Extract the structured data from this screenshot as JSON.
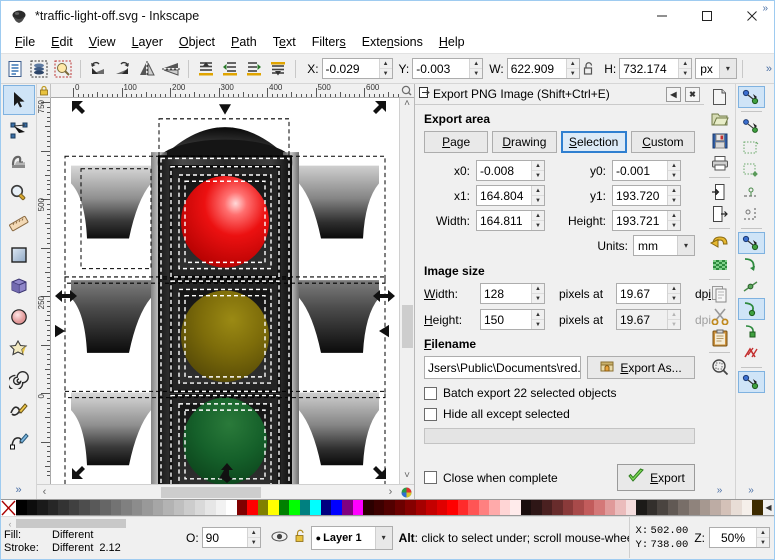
{
  "window": {
    "title": "*traffic-light-off.svg - Inkscape",
    "minimize": "—",
    "maximize": "☐",
    "close": "✕"
  },
  "menubar": {
    "items": [
      "File",
      "Edit",
      "View",
      "Layer",
      "Object",
      "Path",
      "Text",
      "Filters",
      "Extensions",
      "Help"
    ]
  },
  "toolbar": {
    "x_label": "X:",
    "x_value": "-0.029",
    "y_label": "Y:",
    "y_value": "-0.003",
    "w_label": "W:",
    "w_value": "622.909",
    "h_label": "H:",
    "h_value": "732.174",
    "units": "px",
    "lock_icon": "lock-open-icon",
    "overflow": "»",
    "command_icons": [
      "document-properties-icon",
      "xml-editor-icon",
      "zoom-drawing-icon",
      "rotate-ccw-90-icon",
      "rotate-cw-90-icon",
      "flip-horizontal-icon",
      "flip-vertical-icon",
      "raise-to-top-icon",
      "raise-icon",
      "lower-icon",
      "lower-to-bottom-icon"
    ]
  },
  "toolbox": {
    "tools": [
      {
        "name": "selector-tool",
        "active": true
      },
      {
        "name": "node-tool",
        "active": false
      },
      {
        "name": "tweak-tool",
        "active": false
      },
      {
        "name": "zoom-tool",
        "active": false
      },
      {
        "name": "measure-tool",
        "active": false
      },
      {
        "name": "rectangle-tool",
        "active": false
      },
      {
        "name": "box3d-tool",
        "active": false
      },
      {
        "name": "ellipse-tool",
        "active": false
      },
      {
        "name": "star-tool",
        "active": false
      },
      {
        "name": "spiral-tool",
        "active": false
      },
      {
        "name": "pencil-tool",
        "active": false
      },
      {
        "name": "pen-tool",
        "active": false
      }
    ],
    "more": "»"
  },
  "canvas": {
    "hruler_labels": [
      "0",
      "100",
      "200",
      "300",
      "400",
      "500",
      "600"
    ],
    "vruler_labels": [
      "750",
      "500",
      "250",
      "0"
    ],
    "drawing": "traffic-light-illustration",
    "scroll_left_arrow": "‹",
    "scroll_right_arrow": "›",
    "scroll_up_arrow": "˄",
    "scroll_down_arrow": "˅",
    "zoom_corner_icon": "zoom-icon",
    "lock_corner_icon": "ruler-lock-icon",
    "palette_corner_icon": "color-wheel-icon"
  },
  "export_panel": {
    "title": "Export PNG Image (Shift+Ctrl+E)",
    "dock_icon": "dock-icon",
    "collapse_button": "◀",
    "close_button": "✖",
    "area_section": "Export area",
    "area_buttons": [
      {
        "label": "Page",
        "selected": false
      },
      {
        "label": "Drawing",
        "selected": false
      },
      {
        "label": "Selection",
        "selected": true
      },
      {
        "label": "Custom",
        "selected": false
      }
    ],
    "x0_label": "x0:",
    "x0_value": "-0.008",
    "y0_label": "y0:",
    "y0_value": "-0.001",
    "x1_label": "x1:",
    "x1_value": "164.804",
    "y1_label": "y1:",
    "y1_value": "193.720",
    "width_label": "Width:",
    "width_value": "164.811",
    "height_label": "Height:",
    "height_value": "193.721",
    "units_label": "Units:",
    "units_value": "mm",
    "imgsize_section": "Image size",
    "img_width_label": "Width:",
    "img_width_value": "128",
    "img_height_label": "Height:",
    "img_height_value": "150",
    "pixels_at": "pixels at",
    "dpi_label": "dpi",
    "dpi_x_value": "19.67",
    "dpi_y_value": "19.67",
    "filename_section": "Filename",
    "filename_value": "Jsers\\Public\\Documents\\red.",
    "export_as_label": "Export As...",
    "export_as_icon": "folder-hand-icon",
    "batch_label": "Batch export 22 selected objects",
    "batch_checked": false,
    "hide_label": "Hide all except selected",
    "hide_checked": false,
    "close_on_complete_label": "Close when complete",
    "close_on_complete_checked": false,
    "export_label": "Export",
    "export_icon": "green-check-icon"
  },
  "right_dock": {
    "commands": [
      {
        "name": "new-document-icon",
        "sep_after": false
      },
      {
        "name": "open-document-icon",
        "sep_after": false
      },
      {
        "name": "save-document-icon",
        "sep_after": false
      },
      {
        "name": "print-document-icon",
        "sep_after": true
      },
      {
        "name": "import-icon",
        "sep_after": false
      },
      {
        "name": "export-icon",
        "sep_after": true
      },
      {
        "name": "undo-icon",
        "sep_after": false
      },
      {
        "name": "redo-icon",
        "sep_after": true
      },
      {
        "name": "duplicate-icon",
        "sep_after": false
      },
      {
        "name": "cut-icon",
        "sep_after": false
      },
      {
        "name": "paste-icon",
        "sep_after": true
      },
      {
        "name": "zoom-selection-icon",
        "sep_after": false
      }
    ],
    "snap": [
      {
        "name": "enable-snapping-icon",
        "on": true,
        "sep_after": true
      },
      {
        "name": "snap-bounding-box-icon",
        "on": false,
        "sep_after": false
      },
      {
        "name": "snap-bbox-edges-icon",
        "on": false,
        "sep_after": false
      },
      {
        "name": "snap-bbox-corners-icon",
        "on": false,
        "sep_after": false
      },
      {
        "name": "snap-bbox-edge-midpoints-icon",
        "on": false,
        "sep_after": false
      },
      {
        "name": "snap-bbox-centers-icon",
        "on": false,
        "sep_after": true
      },
      {
        "name": "snap-nodes-paths-icon",
        "on": true,
        "sep_after": false
      },
      {
        "name": "snap-path-icon",
        "on": false,
        "sep_after": false
      },
      {
        "name": "snap-path-intersections-icon",
        "on": false,
        "sep_after": false
      },
      {
        "name": "snap-cusp-nodes-icon",
        "on": true,
        "sep_after": false
      },
      {
        "name": "snap-smooth-nodes-icon",
        "on": false,
        "sep_after": false
      },
      {
        "name": "snap-line-midpoints-icon",
        "on": false,
        "sep_after": true
      },
      {
        "name": "snap-others-icon",
        "on": true,
        "sep_after": false
      }
    ],
    "more": "»"
  },
  "palette": {
    "none_swatch": "none-color-icon",
    "scroll_icon": "◀",
    "colors": [
      "#000000",
      "#0d0d0d",
      "#1a1a1a",
      "#262626",
      "#333333",
      "#404040",
      "#4d4d4d",
      "#595959",
      "#666666",
      "#737373",
      "#808080",
      "#8c8c8c",
      "#999999",
      "#a6a6a6",
      "#b3b3b3",
      "#bfbfbf",
      "#cccccc",
      "#d9d9d9",
      "#e6e6e6",
      "#f2f2f2",
      "#ffffff",
      "#800000",
      "#ff0000",
      "#808000",
      "#ffff00",
      "#008000",
      "#00ff00",
      "#008080",
      "#00ffff",
      "#000080",
      "#0000ff",
      "#800080",
      "#ff00ff",
      "#2b0000",
      "#3d0000",
      "#520000",
      "#6b0000",
      "#850000",
      "#a50000",
      "#c40000",
      "#e00000",
      "#ff0000",
      "#ff2b2b",
      "#ff5555",
      "#ff8080",
      "#ffaaaa",
      "#ffd5d5",
      "#ffebeb",
      "#1a0d0d",
      "#2e1616",
      "#4a2020",
      "#682c2c",
      "#8a3a3a",
      "#a84a4a",
      "#c25c5c",
      "#d47878",
      "#e09a9a",
      "#ebbcbc",
      "#f5dede",
      "#1c1a18",
      "#332f2c",
      "#4a4440",
      "#615954",
      "#786e68",
      "#8f837c",
      "#a69890",
      "#bdaca4",
      "#d4c1b8",
      "#e8ddd6",
      "#f5efea",
      "#3d2b00"
    ]
  },
  "statusbar": {
    "fill_label": "Fill:",
    "fill_value": "Different",
    "stroke_label": "Stroke:",
    "stroke_value": "Different",
    "stroke_width": "2.12",
    "opacity_label": "O:",
    "opacity_value": "90",
    "layer_visibility_icon": "eye-icon",
    "layer_lock_icon": "lock-open-icon",
    "layer_name": "Layer 1",
    "hint_prefix": "Alt",
    "hint_text": ": click to select under; scroll mouse-wheel to cycle-select;...",
    "x_label": "X:",
    "x_value": "502.00",
    "y_label": "Y:",
    "y_value": "738.00",
    "zoom_label": "Z:",
    "zoom_value": "50%",
    "expand": "»"
  }
}
